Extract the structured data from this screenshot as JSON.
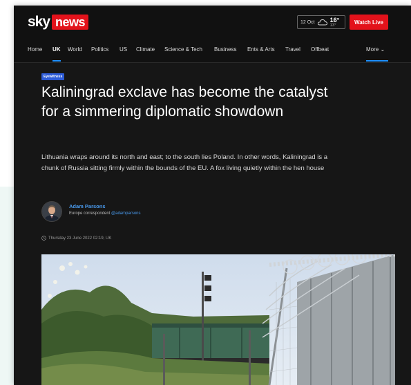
{
  "header": {
    "logo_sky": "sky",
    "logo_news": "news",
    "weather_location": "12 Oct",
    "weather_temp": "16°",
    "weather_low": "13°",
    "watch_live_label": "Watch Live"
  },
  "nav": {
    "items": [
      "Home",
      "UK",
      "World",
      "Politics",
      "US",
      "Climate",
      "Science & Tech",
      "Business",
      "Ents & Arts",
      "Travel",
      "Offbeat"
    ],
    "active": "UK",
    "more_label": "More ⌄"
  },
  "article": {
    "badge": "Eyewitness",
    "headline": "Kaliningrad exclave has become the catalyst for a simmering diplomatic showdown",
    "standfirst": "Lithuania wraps around its north and east; to the south lies Poland. In other words, Kaliningrad is a chunk of Russia sitting firmly within the bounds of the EU. A fox living quietly within the hen house",
    "author_name": "Adam Parsons",
    "author_role": "Europe correspondent",
    "author_handle": "@adamparsons",
    "timestamp": "Thursday 23 June 2022 02:19, UK"
  },
  "colors": {
    "accent_red": "#e3121b",
    "link_blue": "#4a9cf0",
    "badge_blue": "#2d5bd6",
    "background": "#161616"
  }
}
